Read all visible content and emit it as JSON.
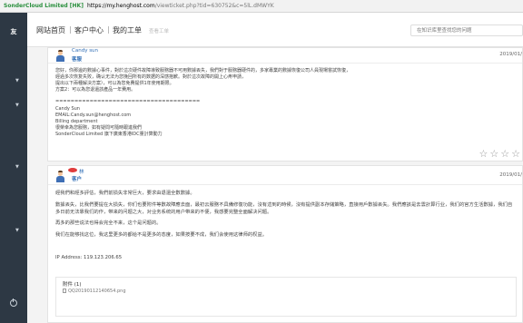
{
  "browser": {
    "secure_label": "SonderCloud Limited [HK]",
    "url_host": "https://my.henghost.com",
    "url_path": "/viewticket.php?tid=630752&c=5lL.dMWYK"
  },
  "sidebar": {
    "logo": "友"
  },
  "topnav": {
    "items": [
      "网站首页",
      "客户中心",
      "我的工单"
    ],
    "separator": "|",
    "sub_label": "查看工单",
    "search_placeholder": "在知识库里查找您的问题"
  },
  "ticket_reply": {
    "author": "Candy sun",
    "role": "客服",
    "date": "2019/01/",
    "lines": [
      "您好，你那邊的數據心事件，對於這次硬件故障導致服務器不可用數據丟失，我們對于服務器硬件的，多家專業的數據恢復公司人員現場嘗試恢復，",
      "經過多次恢复失败，确认无法为您挽回所有的数据的深感抱歉。對於這次故障的開上心疼申請，",
      "提出以下兩種解決方案），可以為您免費提供1年使用期限。",
      "方案2：可以為您退還該產品一年費用。",
      "======================================",
      "Candy Sun",
      "EMAIL:Candy.sun@henghost.com",
      "Billing department",
      "很榮幸為您服務，如有疑問可隨時跟進我們",
      "SonderCloud Limited 旗下廣東香港IDC量計算動力"
    ],
    "rating_stars": "☆☆☆☆"
  },
  "customer_reply": {
    "author": "林",
    "role": "客户",
    "date": "2019/01/",
    "lines": [
      "經我們和經多評估，我們前损失非常巨大，要求由退還全數數據。",
      "數據丟失，比我們要提在大损失，你们也要附件等數故障應去面，最初云服務不具備修復功能，沒有這到的時候，沒有提供副本存儲策略，直接用戶數據丟失。我們應該是去雲計算行业，我们的官方生活數據，我们自",
      "多日前无法靠我们的作，带来的问题之大，对业务系统的用户带来的不便，我感要完整全面解决问题。",
      "再多的那些说法也得会完全不来，这个是问题的。",
      "我们在能够找这位，我这里更多的都给不是更多的态度，如果按要不成，我们会使用这律师的权益。"
    ],
    "ip_label": "IP Address: 119.123.206.65",
    "attachment_title": "附件 (1)",
    "attachment_file": "QQ20190112140654.png"
  }
}
